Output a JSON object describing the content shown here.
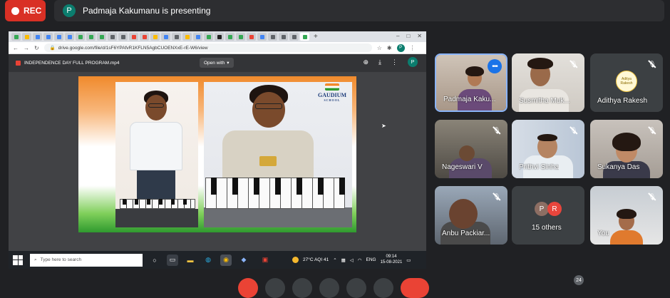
{
  "rec": {
    "label": "REC"
  },
  "presenter": {
    "avatar_letter": "P",
    "text": "Padmaja Kakumanu is presenting"
  },
  "browser": {
    "url": "drive.google.com/file/d/1sF6YPAfvR1KFLN5AgbCUOENXxE-rE-W6/view",
    "profile_letter": "P"
  },
  "drive_viewer": {
    "file_name": "INDEPENDENCE DAY FULL PROGRAM.mp4",
    "open_with": "Open with",
    "profile_letter": "P"
  },
  "video_logo": {
    "name": "GAUDIUM",
    "sub": "SCHOOL"
  },
  "taskbar": {
    "search_placeholder": "Type here to search",
    "weather": "27°C  AQI 41",
    "lang": "ENG",
    "time": "09:14",
    "date": "15-08-2021"
  },
  "participants": [
    {
      "name": "Padmaja Kaku...",
      "muted": false
    },
    {
      "name": "Susmitha Muk...",
      "muted": true
    },
    {
      "name": "Adithya Rakesh",
      "muted": true,
      "logo_text": "Aditya Rakesh"
    },
    {
      "name": "Nageswari V",
      "muted": true
    },
    {
      "name": "Prithvi Sinha",
      "muted": true
    },
    {
      "name": "Sukanya Das",
      "muted": true
    },
    {
      "name": "Anbu Packiar...",
      "muted": true
    },
    {
      "name": "15 others",
      "avatars": [
        "P",
        "R"
      ]
    },
    {
      "name": "You",
      "muted": true
    }
  ],
  "people_badge": "24",
  "colors": {
    "rec": "#d93025",
    "active_speaker": "#8ab4f8",
    "bg": "#202124",
    "tile": "#3c4043"
  }
}
